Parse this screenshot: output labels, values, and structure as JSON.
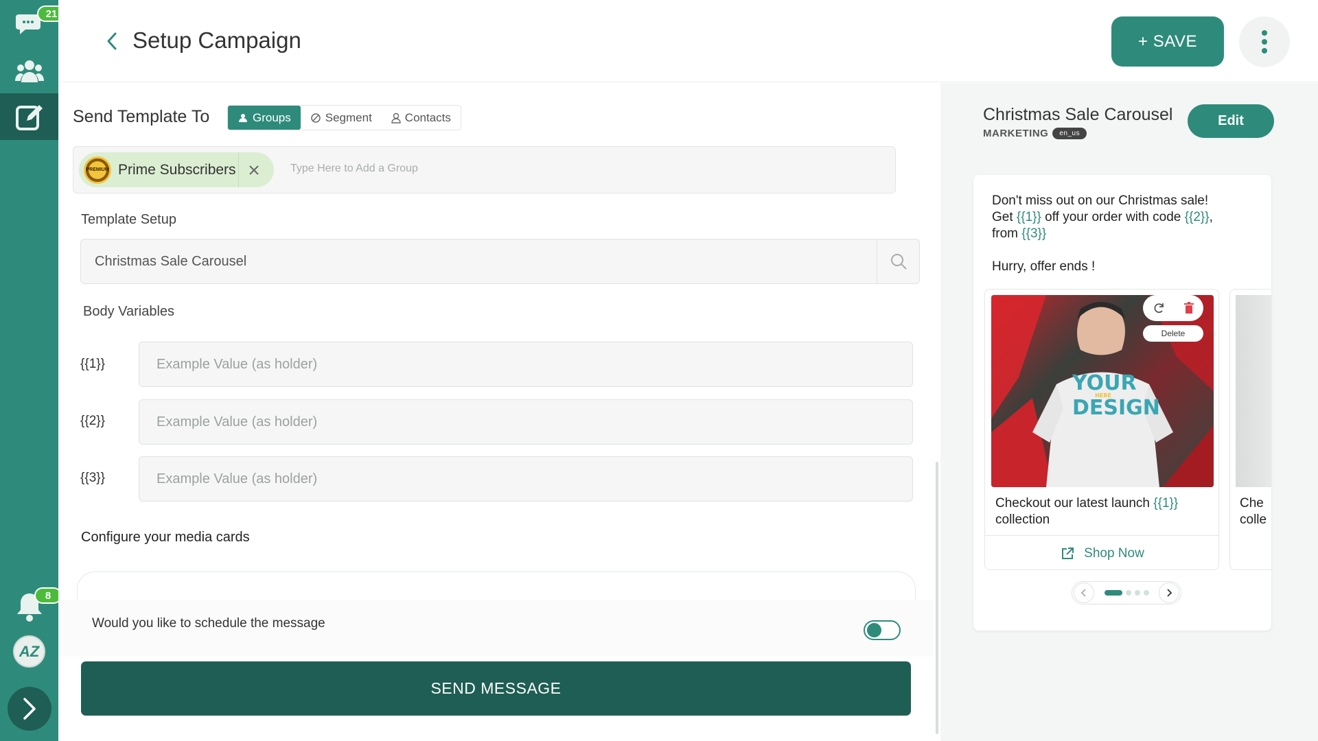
{
  "sidebar": {
    "chat_badge": "21",
    "bell_badge": "8",
    "avatar_initials": "AZ"
  },
  "header": {
    "title": "Setup Campaign",
    "save_label": "+ SAVE"
  },
  "send_to": {
    "label": "Send Template To",
    "tabs": [
      {
        "label": "Groups",
        "icon": "users-icon",
        "active": true
      },
      {
        "label": "Segment",
        "icon": "segment-icon",
        "active": false
      },
      {
        "label": "Contacts",
        "icon": "user-icon",
        "active": false
      }
    ],
    "selected_group": "Prime Subscribers",
    "group_avatar_text": "PREMIUM",
    "group_placeholder": "Type Here to Add a Group"
  },
  "template": {
    "label": "Template Setup",
    "value": "Christmas Sale Carousel"
  },
  "body_variables": {
    "label": "Body Variables",
    "items": [
      {
        "name": "{{1}}",
        "placeholder": "Example Value (as holder)"
      },
      {
        "name": "{{2}}",
        "placeholder": "Example Value (as holder)"
      },
      {
        "name": "{{3}}",
        "placeholder": "Example Value (as holder)"
      }
    ]
  },
  "media": {
    "label": "Configure your media cards"
  },
  "schedule": {
    "label": "Would you like to schedule the message",
    "enabled": false
  },
  "send_label": "SEND MESSAGE",
  "preview": {
    "title": "Christmas Sale Carousel",
    "category": "MARKETING",
    "language": "en_us",
    "edit_label": "Edit",
    "message": {
      "line1": "Don't miss out on our Christmas sale!",
      "line2a": "Get ",
      "var1": "{{1}}",
      "line2b": " off your order with code ",
      "var2": "{{2}}",
      "line2c": ",",
      "line3a": "from ",
      "var3": "{{3}}",
      "line4": "Hurry, offer ends !"
    },
    "card": {
      "image_text_top": "YOUR",
      "image_text_mid": "HERE",
      "image_text_bottom": "DESIGN",
      "delete_label": "Delete",
      "caption_a": "Checkout our latest launch ",
      "caption_var": "{{1}}",
      "caption_b": "collection",
      "button_label": "Shop Now"
    },
    "card2": {
      "caption_line1": "Che",
      "caption_line2": "colle"
    }
  },
  "colors": {
    "brand": "#2e8b7b",
    "brand_dark": "#1f5e54",
    "badge": "#4cbb3c"
  }
}
